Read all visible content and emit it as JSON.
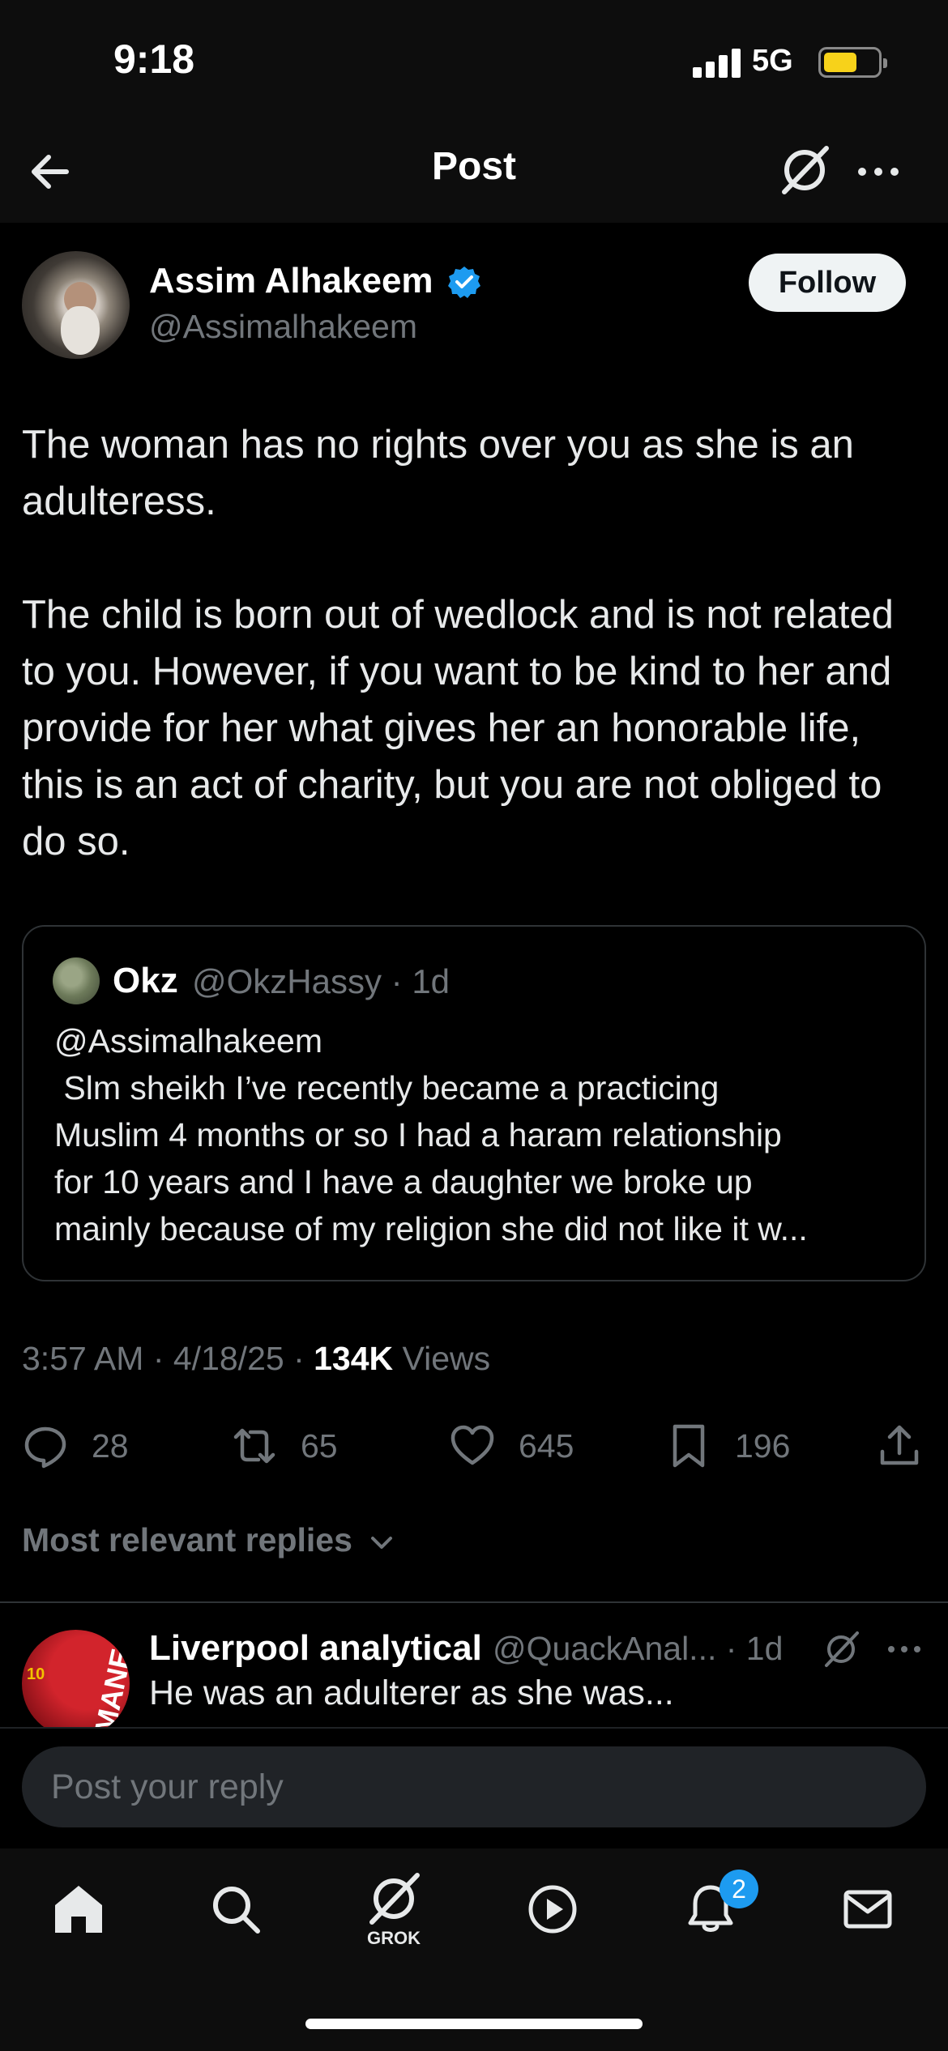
{
  "status_bar": {
    "time": "9:18",
    "network": "5G",
    "battery_level": 0.6,
    "battery_color": "#f7d21a"
  },
  "header": {
    "title": "Post",
    "icons": [
      "back-arrow-icon",
      "grok-icon",
      "more-icon"
    ]
  },
  "author": {
    "name": "Assim Alhakeem",
    "handle": "@Assimalhakeem",
    "verified": true,
    "follow_label": "Follow"
  },
  "post": {
    "paragraphs": [
      "The woman has no rights over you as she is an adulteress.",
      "The child is born out of wedlock and is not related to you. However, if you want to be kind to her and provide for her what gives her an honorable life, this is an act of charity, but you are not obliged to do so."
    ]
  },
  "quote": {
    "name": "Okz",
    "handle": "@OkzHassy",
    "age": "1d",
    "lines": [
      "@Assimalhakeem",
      " Slm sheikh I’ve recently became a practicing",
      "Muslim 4 months or so I had a haram relationship",
      "for 10 years and I have a daughter we broke up",
      "mainly because of my religion she did not like it w..."
    ]
  },
  "meta": {
    "time": "3:57 AM",
    "date": "4/18/25",
    "views_count": "134K",
    "views_label": "Views"
  },
  "actions": {
    "replies": "28",
    "reposts": "65",
    "likes": "645",
    "bookmarks": "196"
  },
  "sort": {
    "label": "Most relevant replies"
  },
  "reply": {
    "name": "Liverpool analytical",
    "handle": "@QuackAnal...",
    "age": "1d",
    "text": "He was an adulterer as she was..."
  },
  "composer": {
    "placeholder": "Post your reply"
  },
  "nav": {
    "grok_label": "GROK",
    "notifications_badge": "2",
    "accent_color": "#1d9bf0"
  }
}
